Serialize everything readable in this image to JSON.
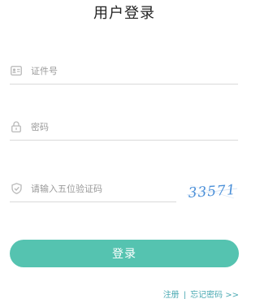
{
  "page": {
    "title": "用户登录"
  },
  "form": {
    "id_field": {
      "placeholder": "证件号",
      "value": "",
      "icon": "id-card-icon"
    },
    "password_field": {
      "placeholder": "密码",
      "value": "",
      "icon": "lock-icon"
    },
    "captcha_field": {
      "placeholder": "请输入五位验证码",
      "value": "",
      "icon": "shield-check-icon"
    },
    "captcha_image": {
      "text": "33571"
    },
    "submit_label": "登录"
  },
  "links": {
    "register": "注册",
    "separator": "|",
    "forgot_password": "忘记密码 >>"
  },
  "colors": {
    "accent": "#55c3b0",
    "link": "#4aa9b2",
    "captcha_text": "#4a8fd8",
    "icon": "#b8b8b8"
  }
}
